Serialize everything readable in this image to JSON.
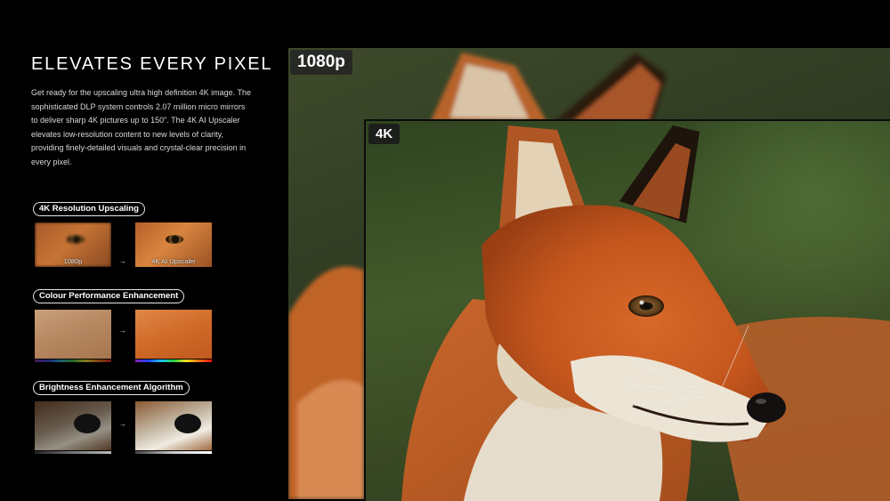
{
  "headline": "ELEVATES EVERY PIXEL",
  "body": "Get ready for the upscaling ultra high definition 4K image. The sophisticated DLP system controls 2.07 million micro mirrors to deliver sharp 4K pictures up to 150\". The 4K AI Upscaler elevates low-resolution content to new levels of clarity, providing finely-detailed visuals and crystal-clear precision in every pixel.",
  "features": [
    {
      "label": "4K Resolution Upscaling",
      "before_caption": "1080p",
      "after_caption": "4K AI Upscaler"
    },
    {
      "label": "Colour Performance Enhancement"
    },
    {
      "label": "Brightness Enhancement Algorithm"
    }
  ],
  "arrow_glyph": "→",
  "panels": {
    "back_label": "1080p",
    "front_label": "4K"
  },
  "colors": {
    "background": "#000000",
    "fox_orange": "#c9591e",
    "fur_white": "#e8e2cf",
    "foliage_green": "#3e5428"
  }
}
